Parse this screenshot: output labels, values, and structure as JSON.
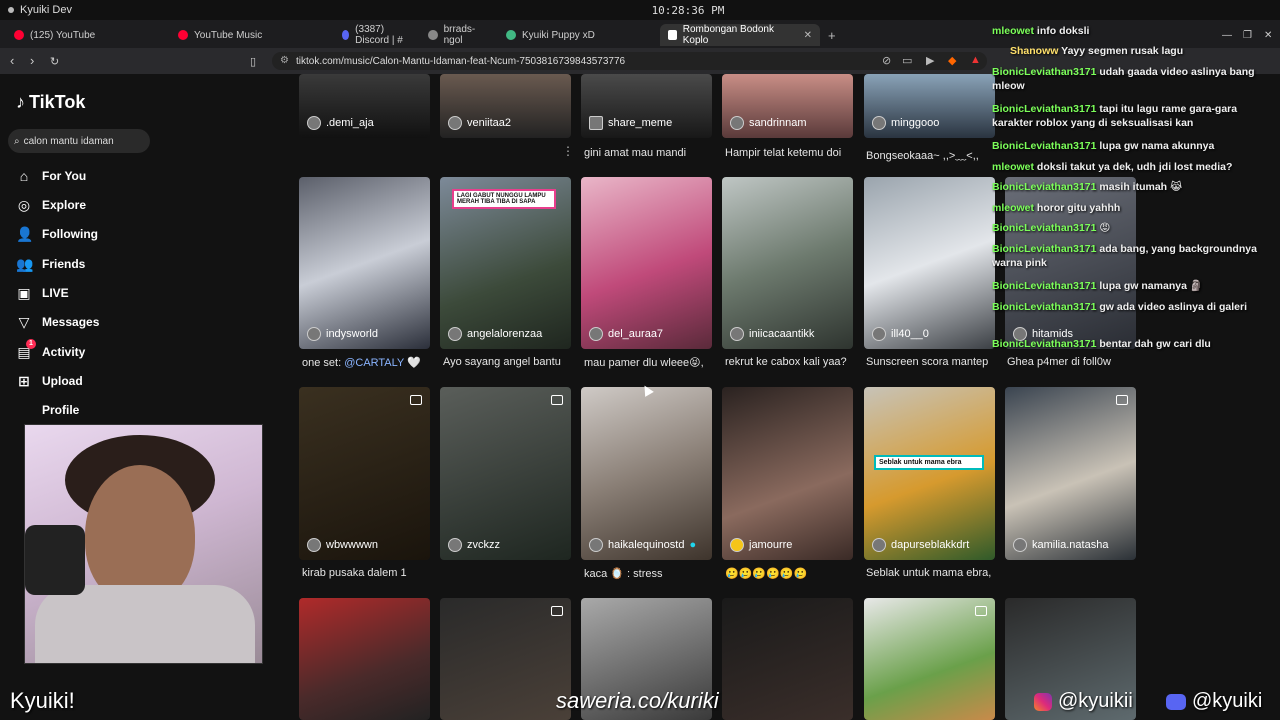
{
  "os": {
    "workspace": "Kyuiki Dev",
    "clock": "10:28:36 PM"
  },
  "tabs": [
    {
      "label": "(125) YouTube",
      "color": "#ff0033"
    },
    {
      "label": "YouTube Music",
      "color": "#ff0033"
    },
    {
      "label": "(3387) Discord | #",
      "color": "#5865f2"
    },
    {
      "label": "brrads-ngol",
      "color": "#888888"
    },
    {
      "label": "Kyuiki Puppy xD",
      "color": "#41b883"
    },
    {
      "label": "Rombongan Bodonk Koplo",
      "color": "#ffffff",
      "active": true
    }
  ],
  "address": {
    "url": "tiktok.com/music/Calon-Mantu-Idaman-feat-Ncum-7503816739843573776"
  },
  "tiktok": {
    "brand": "TikTok",
    "search_value": "calon mantu idaman",
    "nav": [
      {
        "label": "For You",
        "icon": "home-icon"
      },
      {
        "label": "Explore",
        "icon": "compass-icon"
      },
      {
        "label": "Following",
        "icon": "following-icon"
      },
      {
        "label": "Friends",
        "icon": "friends-icon"
      },
      {
        "label": "LIVE",
        "icon": "live-icon"
      },
      {
        "label": "Messages",
        "icon": "messages-icon"
      },
      {
        "label": "Activity",
        "icon": "activity-icon",
        "badge": "1"
      },
      {
        "label": "Upload",
        "icon": "upload-icon"
      },
      {
        "label": "Profile",
        "icon": "profile-icon"
      }
    ],
    "row0": [
      {
        "user": ".demi_aja",
        "caption": ""
      },
      {
        "user": "veniitaa2",
        "caption": ""
      },
      {
        "user": "share_meme",
        "caption": "gini amat mau mandi"
      },
      {
        "user": "sandrinnam",
        "caption": "Hampir telat ketemu doi"
      },
      {
        "user": "minggooo",
        "caption": "Bongseokaaa~ ,,>﹏<,,"
      }
    ],
    "row1": [
      {
        "user": "indysworld",
        "caption": "one set: ",
        "tag": "@CARTALY",
        "suffix": " 🤍"
      },
      {
        "user": "angelalorenzaa",
        "caption": "Ayo sayang angel bantu",
        "overlay": "LAGI GABUT NUNGGU LAMPU MERAH TIBA TIBA DI SAPA"
      },
      {
        "user": "del_auraa7",
        "caption": "mau pamer dlu wleee😝,"
      },
      {
        "user": "iniicacaantikk",
        "caption": "rekrut ke cabox kali yaa?"
      },
      {
        "user": "ill40__0",
        "caption": "Sunscreen scora mantep"
      },
      {
        "user": "hitamids",
        "caption": "Ghea p4mer di foll0w"
      }
    ],
    "row2": [
      {
        "user": "wbwwwwn",
        "caption": "kirab pusaka dalem 1"
      },
      {
        "user": "zvckzz",
        "caption": ""
      },
      {
        "user": "haikalequinostd",
        "caption": "kaca 🪞 : stress"
      },
      {
        "user": "jamourre",
        "caption": "🥲🥲🥲🥲🥲🥲"
      },
      {
        "user": "dapurseblakkdrt",
        "caption": "Seblak untuk mama ebra,",
        "overlay": "Seblak untuk mama ebra"
      },
      {
        "user": "kamilia.natasha",
        "caption": ""
      }
    ]
  },
  "chat": [
    {
      "user": "mleowet",
      "text": " info doksli"
    },
    {
      "user": "Shanoww",
      "text": " Yayy segmen rusak lagu",
      "highlight": true
    },
    {
      "user": "BionicLeviathan3171",
      "text": " udah gaada video aslinya bang mleow"
    },
    {
      "user": "BionicLeviathan3171",
      "text": " tapi itu lagu rame gara-gara karakter roblox yang di seksualisasi kan"
    },
    {
      "user": "BionicLeviathan3171",
      "text": " lupa gw nama akunnya"
    },
    {
      "user": "mleowet",
      "text": " doksli takut ya dek, udh jdi lost media?"
    },
    {
      "user": "BionicLeviathan3171",
      "text": " masih itumah 😹"
    },
    {
      "user": "mleowet",
      "text": " horor gitu yahhh"
    },
    {
      "user": "BionicLeviathan3171",
      "text": " 😡"
    },
    {
      "user": "BionicLeviathan3171",
      "text": " ada bang, yang backgroundnya warna pink"
    },
    {
      "user": "BionicLeviathan3171",
      "text": " lupa gw namanya 🗿"
    },
    {
      "user": "BionicLeviathan3171",
      "text": " gw ada video aslinya di galeri"
    },
    {
      "user": "BionicLeviathan3171",
      "text": " bentar dah gw cari dlu"
    }
  ],
  "overlay": {
    "streamer": "Kyuiki!",
    "donate": "saweria.co/kuriki",
    "instagram": "@kyuikii",
    "discord": "@kyuiki"
  }
}
